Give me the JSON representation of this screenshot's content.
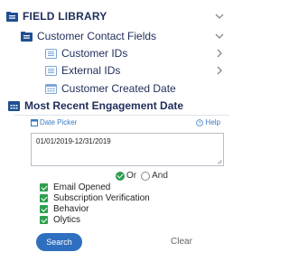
{
  "tree": {
    "root": {
      "label": "FIELD LIBRARY",
      "icon": "folder-icon"
    },
    "group": {
      "label": "Customer Contact Fields",
      "icon": "folder-icon"
    },
    "items": [
      {
        "label": "Customer IDs",
        "icon": "list-icon"
      },
      {
        "label": "External IDs",
        "icon": "list-icon"
      },
      {
        "label": "Customer Created Date",
        "icon": "calendar-icon"
      }
    ],
    "active_field": {
      "label": "Most Recent Engagement Date",
      "icon": "calendar-icon"
    }
  },
  "panel": {
    "date_picker_label": "Date Picker",
    "help_label": "Help",
    "date_value": "01/01/2019-12/31/2019",
    "logic": {
      "or_label": "Or",
      "and_label": "And",
      "selected": "Or"
    },
    "checks": [
      {
        "label": "Email Opened",
        "checked": true
      },
      {
        "label": "Subscription Verification",
        "checked": true
      },
      {
        "label": "Behavior",
        "checked": true
      },
      {
        "label": "Olytics",
        "checked": true
      }
    ],
    "search_label": "Search",
    "clear_label": "Clear"
  },
  "colors": {
    "text_primary": "#1f2d5a",
    "accent_blue": "#2f6fbf",
    "link_blue": "#3a78c4",
    "check_green": "#2d9f4e"
  }
}
